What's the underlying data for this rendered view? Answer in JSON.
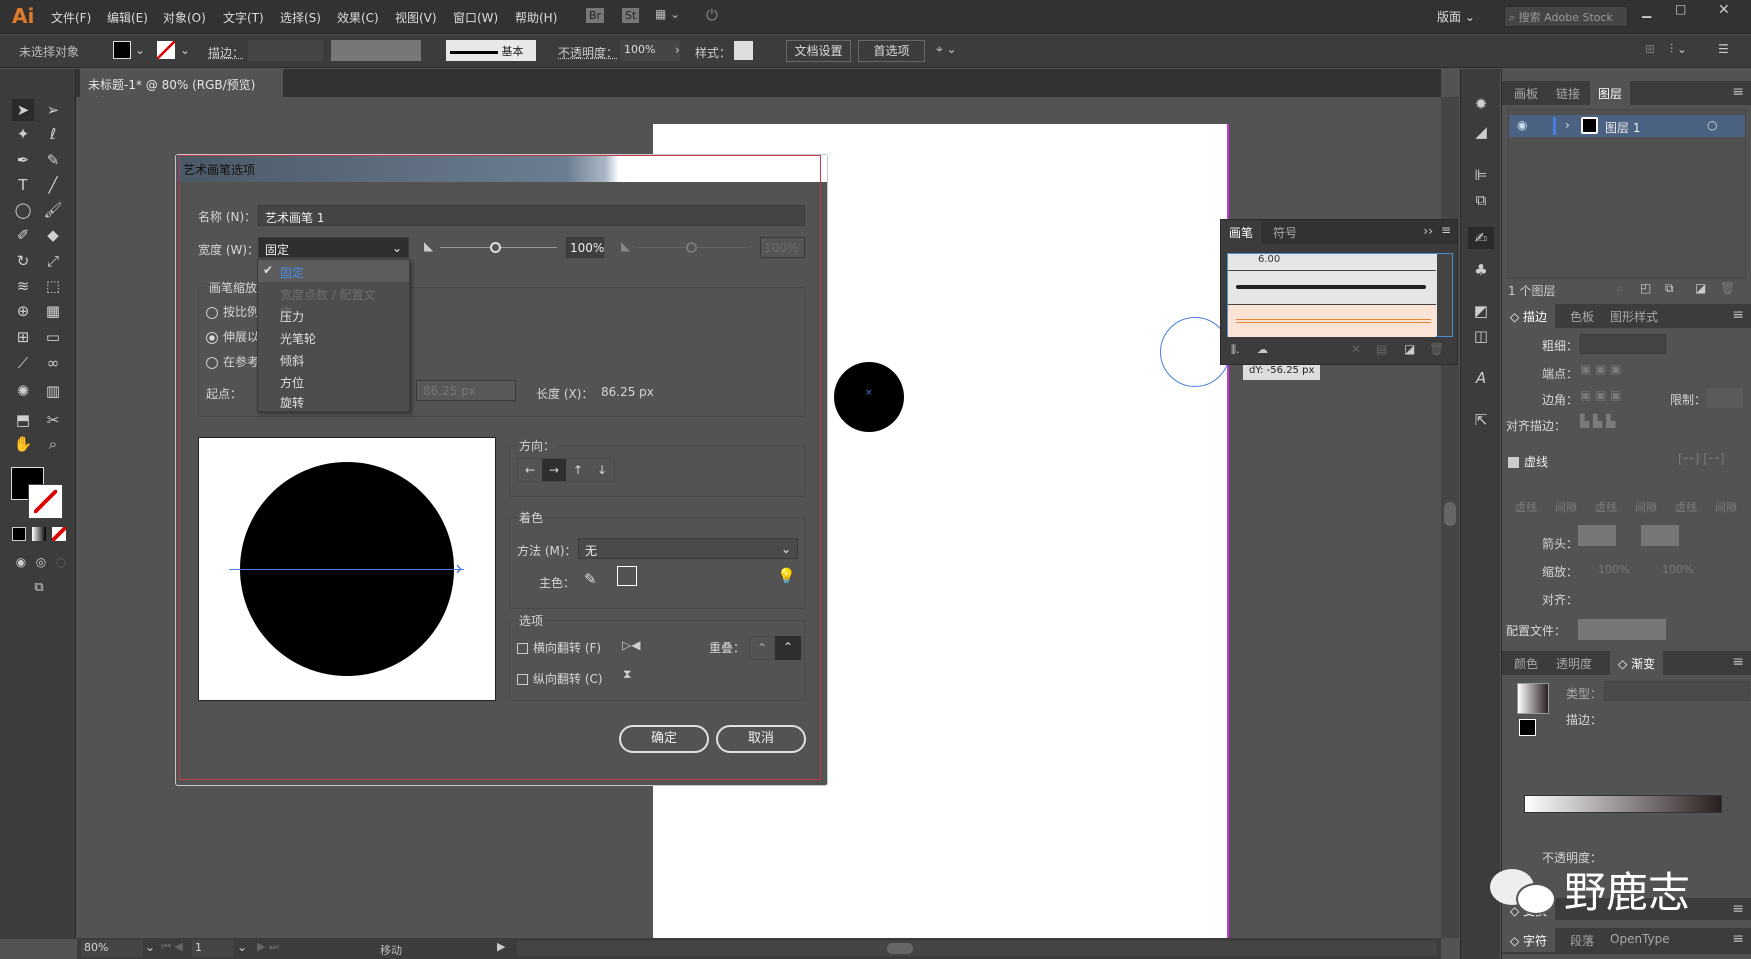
{
  "app": {
    "logo": "Ai",
    "menus": [
      "文件(F)",
      "编辑(E)",
      "对象(O)",
      "文字(T)",
      "选择(S)",
      "效果(C)",
      "视图(V)",
      "窗口(W)",
      "帮助(H)"
    ],
    "bridge": "Br",
    "stock": "St",
    "workspace": "版面",
    "search_placeholder": "搜索 Adobe Stock"
  },
  "control": {
    "selection": "未选择对象",
    "stroke_label": "描边：",
    "stroke_style": "基本",
    "opacity_label": "不透明度：",
    "opacity": "100%",
    "style_label": "样式：",
    "doc_setup": "文档设置",
    "prefs": "首选项"
  },
  "document": {
    "tab": "未标题-1* @ 80% (RGB/预览)",
    "close": "×"
  },
  "status": {
    "zoom": "80%",
    "artboard": "1",
    "tool": "移动"
  },
  "tooltip": "dY: -56.25 px",
  "brushes_panel": {
    "tabs": [
      "画笔",
      "符号"
    ],
    "size_label": "6.00"
  },
  "dialog": {
    "title": "艺术画笔选项",
    "name_label": "名称 (N)：",
    "name_value": "艺术画笔 1",
    "width_label": "宽度 (W)：",
    "width_value": "固定",
    "width_pct": "100%",
    "width_pct2": "100%",
    "width_options": [
      {
        "label": "固定",
        "selected": true
      },
      {
        "label": "宽度点数 / 配置文件",
        "disabled": true
      },
      {
        "label": "压力"
      },
      {
        "label": "光笔轮"
      },
      {
        "label": "倾斜"
      },
      {
        "label": "方位"
      },
      {
        "label": "旋转"
      }
    ],
    "scale_group": "画笔缩放",
    "scale_options": [
      "按比例",
      "伸展以",
      "在参考"
    ],
    "scale_selected": 1,
    "start_label": "起点：",
    "end_value": "86.25 px",
    "length_label": "长度 (X)：",
    "length_value": "86.25 px",
    "direction_label": "方向：",
    "directions": [
      "←",
      "→",
      "↑",
      "↓"
    ],
    "direction_selected": 1,
    "colorize_label": "着色",
    "method_label": "方法 (M)：",
    "method_value": "无",
    "key_color_label": "主色：",
    "key_color": "#000000",
    "options_label": "选项",
    "flip_h": "横向翻转 (F)",
    "flip_v": "纵向翻转 (C)",
    "overlap_label": "重叠：",
    "ok": "确定",
    "cancel": "取消"
  },
  "right_panels": {
    "layers_tabs": [
      "画板",
      "链接",
      "图层"
    ],
    "layer_name": "图层 1",
    "layer_count": "1 个图层",
    "stroke_tabs": [
      "描边",
      "色板",
      "图形样式"
    ],
    "weight_label": "粗细：",
    "cap_label": "端点：",
    "corner_label": "边角：",
    "limit_label": "限制：",
    "align_label": "对齐描边：",
    "dash_label": "虚线",
    "dash_cells": [
      "虚线",
      "间隙",
      "虚线",
      "间隙",
      "虚线",
      "间隙"
    ],
    "arrow_label": "箭头：",
    "scale_label": "缩放：",
    "scale1": "100%",
    "scale2": "100%",
    "align2_label": "对齐：",
    "profile_label": "配置文件：",
    "gradient_tabs": [
      "颜色",
      "透明度",
      "渐变"
    ],
    "type_label": "类型：",
    "gstroke_label": "描边：",
    "gopacity_label": "不透明度：",
    "transform_tab": "变换",
    "char_tabs": [
      "字符",
      "段落",
      "OpenType"
    ]
  },
  "watermark": "野鹿志"
}
